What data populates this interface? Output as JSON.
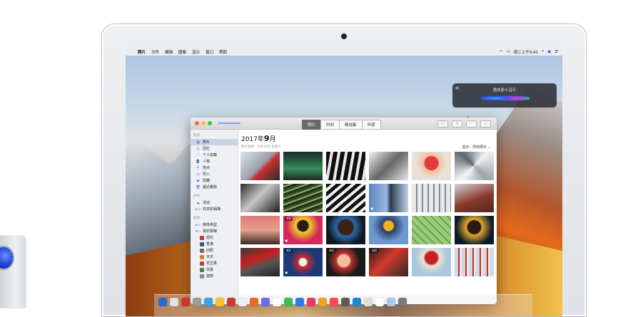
{
  "menubar": {
    "apple": "",
    "items": [
      "照片",
      "文件",
      "编辑",
      "图像",
      "显示",
      "窗口",
      "帮助"
    ],
    "clock": "周二上午9:41"
  },
  "siri": {
    "text": "播放爵士音乐"
  },
  "photos": {
    "tabs": [
      {
        "label": "照片",
        "active": true
      },
      {
        "label": "时刻",
        "active": false
      },
      {
        "label": "精选集",
        "active": false
      },
      {
        "label": "年度",
        "active": false
      }
    ],
    "heading": {
      "year": "2017年",
      "month": "9",
      "suffix": "月"
    },
    "subheading": "照片图库 · 166,876 张照片",
    "show_filter": "显示：所有照片",
    "sidebar": {
      "section_photos": "图库",
      "items_main": [
        {
          "label": "照片",
          "icon": "photo-icon",
          "glyph": "▦",
          "selected": true
        },
        {
          "label": "回忆",
          "icon": "memories-icon",
          "glyph": "◎",
          "selected": false
        },
        {
          "label": "个人收藏",
          "icon": "heart-icon",
          "glyph": "♡",
          "selected": false
        },
        {
          "label": "人物",
          "icon": "person-icon",
          "glyph": "👤",
          "selected": false
        },
        {
          "label": "地点",
          "icon": "pin-icon",
          "glyph": "⚲",
          "selected": false
        },
        {
          "label": "导入",
          "icon": "clock-icon",
          "glyph": "◷",
          "selected": false
        },
        {
          "label": "隐藏",
          "icon": "eye-icon",
          "glyph": "◉",
          "selected": false
        },
        {
          "label": "最近删除",
          "icon": "trash-icon",
          "glyph": "🗑",
          "selected": false
        }
      ],
      "section_shared": "共享",
      "items_shared": [
        {
          "label": "活动",
          "icon": "cloud-icon",
          "glyph": "☁"
        },
        {
          "label": "共享的相簿",
          "icon": "folder-icon",
          "glyph": "▸▭"
        }
      ],
      "section_albums": "相簿",
      "items_albums": [
        {
          "label": "媒体类型",
          "icon": "folder-icon",
          "glyph": "▸▭"
        },
        {
          "label": "我的相簿",
          "icon": "folder-icon",
          "glyph": "▾▭"
        }
      ],
      "items_my_albums": [
        {
          "label": "纽约",
          "color": "#b8412d"
        },
        {
          "label": "香港",
          "color": "#2f5d8a"
        },
        {
          "label": "旧照",
          "color": "#7a6a4f"
        },
        {
          "label": "天天",
          "color": "#d0842b"
        },
        {
          "label": "花生果",
          "color": "#c23a3a"
        },
        {
          "label": "风景",
          "color": "#3c8a5a"
        },
        {
          "label": "建筑",
          "color": "#8a8f96"
        }
      ]
    },
    "grid": [
      [
        {
          "bg": "linear-gradient(135deg,#dfe3e8,#9aa1a9 50%,#c83030 60%,#2a2a2a)",
          "badge": "",
          "heart": false
        },
        {
          "bg": "linear-gradient(#1d2a2a,#2a6a45 40%,#3a8c5c 60%,#1b2a1a)",
          "badge": "",
          "heart": false
        },
        {
          "bg": "repeating-linear-gradient(100deg,#111 0 6px,#eaeaea 6px 10px)",
          "badge": "",
          "heart": false
        },
        {
          "bg": "linear-gradient(135deg,#f2f2f2,#666 50%,#e6e6e6)",
          "badge": "",
          "heart": false
        },
        {
          "bg": "radial-gradient(circle at 50% 40%,#e23a3a 0 25%,#f0c0a0 30%,#e8e1da 60%)",
          "badge": "",
          "heart": false
        },
        {
          "bg": "conic-gradient(from 45deg,#f0f0f0,#9aa4ad,#f5f5f5,#5d656d,#f0f0f0)",
          "badge": "",
          "heart": false
        }
      ],
      [
        {
          "bg": "linear-gradient(135deg,#2a2a2a,#c8c8c8 45%,#1a1a1a)",
          "badge": "",
          "heart": false
        },
        {
          "bg": "repeating-linear-gradient(160deg,#3a4a2a 0 3px,#8fb06a 3px 5px,#203015 5px 8px)",
          "badge": "",
          "heart": false
        },
        {
          "bg": "repeating-linear-gradient(140deg,#111 0 5px,#f0f0f0 5px 9px)",
          "badge": "",
          "heart": false
        },
        {
          "bg": "linear-gradient(90deg,#5d86c4,#9ab6de 45%,#2a3a52 55%,#c0d2ea)",
          "badge": "",
          "heart": true
        },
        {
          "bg": "repeating-linear-gradient(90deg,#e8e8e8 0 6px,#7a8a96 6px 8px)",
          "badge": "",
          "heart": false
        },
        {
          "bg": "linear-gradient(160deg,#cfd6dd,#8a3a2a 55%,#4a2a20)",
          "badge": "",
          "heart": false
        }
      ],
      [
        {
          "bg": "linear-gradient(#d97a7a,#e8a08a 50%,#3a2a2a)",
          "badge": "",
          "heart": false
        },
        {
          "bg": "radial-gradient(circle at 50% 35%,#2a1a12 0 20%,#f0d22a 24%,#d42a5a 60%)",
          "badge": "资料",
          "heart": true
        },
        {
          "bg": "radial-gradient(circle at 50% 40%,#3a2418 0 28%,#2a6aaa 35%,#101820 70%)",
          "badge": "",
          "heart": false
        },
        {
          "bg": "radial-gradient(circle at 50% 35%,#f2b31a 0 18%,#2d3d6a 22%,#6a9ad0 60%)",
          "badge": "",
          "heart": false
        },
        {
          "bg": "repeating-linear-gradient(45deg,#9acb7a 0 6px,#6fa050 6px 8px)",
          "badge": "",
          "heart": false
        },
        {
          "bg": "radial-gradient(circle at 50% 40%,#2a1a10 0 25%,#e0a82a 30%,#0a1a2a 70%)",
          "badge": "",
          "heart": false
        }
      ],
      [
        {
          "bg": "linear-gradient(160deg,#3a3a3a,#c82020 40%,#555 60%,#222)",
          "badge": "",
          "heart": false
        },
        {
          "bg": "radial-gradient(circle at 50% 50%,#f0f0f0 0 15%,#c82a2a 20%,#1a3a7a 55%)",
          "badge": "资料",
          "heart": true
        },
        {
          "bg": "radial-gradient(circle at 45% 45%,#f2c0a0 0 22%,#c03030 28%,#1a1a1a 60%)",
          "badge": "资料",
          "heart": false
        },
        {
          "bg": "linear-gradient(135deg,#1a1a1a,#d23a2a 45%,#2a2a2a)",
          "badge": "资料",
          "heart": false
        },
        {
          "bg": "radial-gradient(circle at 50% 35%,#c82020 0 22%,#f0e0d0 30%,#a8c8e0 60%)",
          "badge": "",
          "heart": false
        },
        {
          "bg": "repeating-linear-gradient(90deg,#d0d8e0 0 5px,#c82a2a 5px 7px,#e8e8e8 7px 10px)",
          "badge": "",
          "heart": false
        }
      ]
    ]
  },
  "dock": {
    "icons": [
      "#2a6ad8",
      "#e0e0e0",
      "#c83a2a",
      "#9a9a9a",
      "#3aa0e8",
      "#f5c330",
      "#c83a3a",
      "#f0f0f0",
      "#e86a2a",
      "#6a6af0",
      "#ffffff",
      "#3ac05a",
      "#2a7ae8",
      "#e83a6a",
      "#f5a020",
      "#ff4a4a",
      "#5a5a5a",
      "#1a8ad8",
      "#dddddd",
      "#ffffff",
      "#aac8e8",
      "#7a7a7a"
    ]
  }
}
